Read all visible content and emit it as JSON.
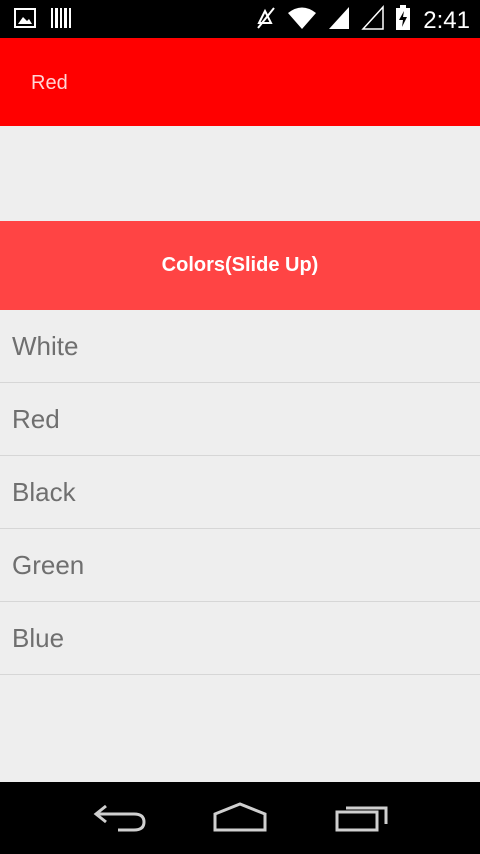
{
  "status_bar": {
    "time": "2:41",
    "icons": [
      "image-icon",
      "barcode-icon",
      "mute-icon",
      "wifi-icon",
      "signal-icon",
      "signal-empty-icon",
      "battery-charging-icon"
    ]
  },
  "header": {
    "title": "Red",
    "color": "#ff0000"
  },
  "panel": {
    "handle_label": "Colors(Slide Up)",
    "color": "#ff4444"
  },
  "list": {
    "items": [
      {
        "label": "White"
      },
      {
        "label": "Red"
      },
      {
        "label": "Black"
      },
      {
        "label": "Green"
      },
      {
        "label": "Blue"
      }
    ]
  },
  "nav_bar": {
    "icons": [
      "back-icon",
      "home-icon",
      "recents-icon"
    ]
  }
}
